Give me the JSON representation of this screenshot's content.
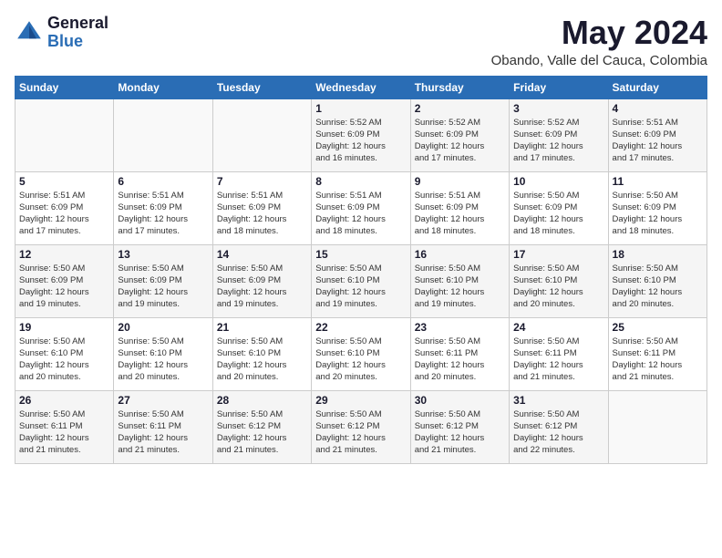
{
  "header": {
    "logo_line1": "General",
    "logo_line2": "Blue",
    "month": "May 2024",
    "location": "Obando, Valle del Cauca, Colombia"
  },
  "days_of_week": [
    "Sunday",
    "Monday",
    "Tuesday",
    "Wednesday",
    "Thursday",
    "Friday",
    "Saturday"
  ],
  "weeks": [
    {
      "cells": [
        {
          "day": "",
          "info": ""
        },
        {
          "day": "",
          "info": ""
        },
        {
          "day": "",
          "info": ""
        },
        {
          "day": "1",
          "info": "Sunrise: 5:52 AM\nSunset: 6:09 PM\nDaylight: 12 hours\nand 16 minutes."
        },
        {
          "day": "2",
          "info": "Sunrise: 5:52 AM\nSunset: 6:09 PM\nDaylight: 12 hours\nand 17 minutes."
        },
        {
          "day": "3",
          "info": "Sunrise: 5:52 AM\nSunset: 6:09 PM\nDaylight: 12 hours\nand 17 minutes."
        },
        {
          "day": "4",
          "info": "Sunrise: 5:51 AM\nSunset: 6:09 PM\nDaylight: 12 hours\nand 17 minutes."
        }
      ]
    },
    {
      "cells": [
        {
          "day": "5",
          "info": "Sunrise: 5:51 AM\nSunset: 6:09 PM\nDaylight: 12 hours\nand 17 minutes."
        },
        {
          "day": "6",
          "info": "Sunrise: 5:51 AM\nSunset: 6:09 PM\nDaylight: 12 hours\nand 17 minutes."
        },
        {
          "day": "7",
          "info": "Sunrise: 5:51 AM\nSunset: 6:09 PM\nDaylight: 12 hours\nand 18 minutes."
        },
        {
          "day": "8",
          "info": "Sunrise: 5:51 AM\nSunset: 6:09 PM\nDaylight: 12 hours\nand 18 minutes."
        },
        {
          "day": "9",
          "info": "Sunrise: 5:51 AM\nSunset: 6:09 PM\nDaylight: 12 hours\nand 18 minutes."
        },
        {
          "day": "10",
          "info": "Sunrise: 5:50 AM\nSunset: 6:09 PM\nDaylight: 12 hours\nand 18 minutes."
        },
        {
          "day": "11",
          "info": "Sunrise: 5:50 AM\nSunset: 6:09 PM\nDaylight: 12 hours\nand 18 minutes."
        }
      ]
    },
    {
      "cells": [
        {
          "day": "12",
          "info": "Sunrise: 5:50 AM\nSunset: 6:09 PM\nDaylight: 12 hours\nand 19 minutes."
        },
        {
          "day": "13",
          "info": "Sunrise: 5:50 AM\nSunset: 6:09 PM\nDaylight: 12 hours\nand 19 minutes."
        },
        {
          "day": "14",
          "info": "Sunrise: 5:50 AM\nSunset: 6:09 PM\nDaylight: 12 hours\nand 19 minutes."
        },
        {
          "day": "15",
          "info": "Sunrise: 5:50 AM\nSunset: 6:10 PM\nDaylight: 12 hours\nand 19 minutes."
        },
        {
          "day": "16",
          "info": "Sunrise: 5:50 AM\nSunset: 6:10 PM\nDaylight: 12 hours\nand 19 minutes."
        },
        {
          "day": "17",
          "info": "Sunrise: 5:50 AM\nSunset: 6:10 PM\nDaylight: 12 hours\nand 20 minutes."
        },
        {
          "day": "18",
          "info": "Sunrise: 5:50 AM\nSunset: 6:10 PM\nDaylight: 12 hours\nand 20 minutes."
        }
      ]
    },
    {
      "cells": [
        {
          "day": "19",
          "info": "Sunrise: 5:50 AM\nSunset: 6:10 PM\nDaylight: 12 hours\nand 20 minutes."
        },
        {
          "day": "20",
          "info": "Sunrise: 5:50 AM\nSunset: 6:10 PM\nDaylight: 12 hours\nand 20 minutes."
        },
        {
          "day": "21",
          "info": "Sunrise: 5:50 AM\nSunset: 6:10 PM\nDaylight: 12 hours\nand 20 minutes."
        },
        {
          "day": "22",
          "info": "Sunrise: 5:50 AM\nSunset: 6:10 PM\nDaylight: 12 hours\nand 20 minutes."
        },
        {
          "day": "23",
          "info": "Sunrise: 5:50 AM\nSunset: 6:11 PM\nDaylight: 12 hours\nand 20 minutes."
        },
        {
          "day": "24",
          "info": "Sunrise: 5:50 AM\nSunset: 6:11 PM\nDaylight: 12 hours\nand 21 minutes."
        },
        {
          "day": "25",
          "info": "Sunrise: 5:50 AM\nSunset: 6:11 PM\nDaylight: 12 hours\nand 21 minutes."
        }
      ]
    },
    {
      "cells": [
        {
          "day": "26",
          "info": "Sunrise: 5:50 AM\nSunset: 6:11 PM\nDaylight: 12 hours\nand 21 minutes."
        },
        {
          "day": "27",
          "info": "Sunrise: 5:50 AM\nSunset: 6:11 PM\nDaylight: 12 hours\nand 21 minutes."
        },
        {
          "day": "28",
          "info": "Sunrise: 5:50 AM\nSunset: 6:12 PM\nDaylight: 12 hours\nand 21 minutes."
        },
        {
          "day": "29",
          "info": "Sunrise: 5:50 AM\nSunset: 6:12 PM\nDaylight: 12 hours\nand 21 minutes."
        },
        {
          "day": "30",
          "info": "Sunrise: 5:50 AM\nSunset: 6:12 PM\nDaylight: 12 hours\nand 21 minutes."
        },
        {
          "day": "31",
          "info": "Sunrise: 5:50 AM\nSunset: 6:12 PM\nDaylight: 12 hours\nand 22 minutes."
        },
        {
          "day": "",
          "info": ""
        }
      ]
    }
  ]
}
